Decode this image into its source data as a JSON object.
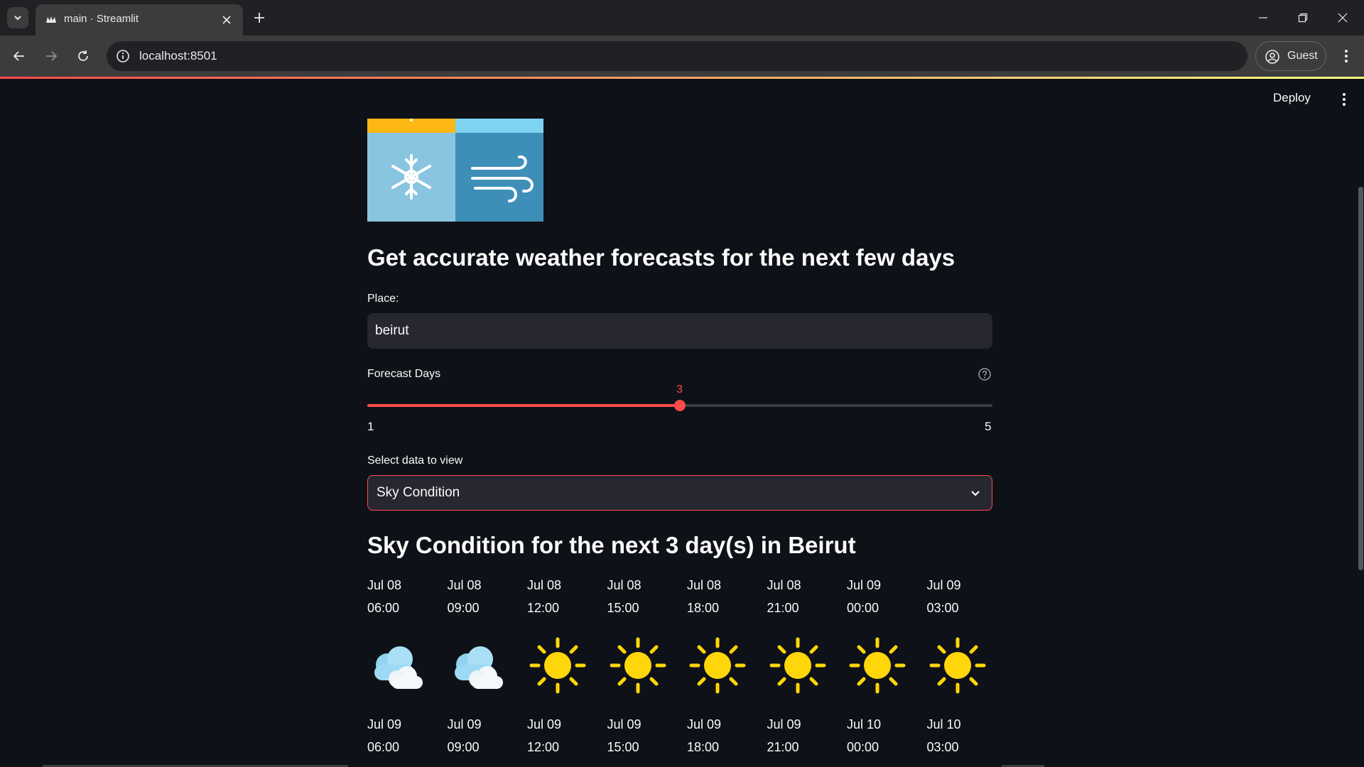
{
  "browser": {
    "tab_title": "main · Streamlit",
    "url": "localhost:8501",
    "profile_label": "Guest"
  },
  "app": {
    "deploy_label": "Deploy",
    "headline": "Get accurate weather forecasts for the next few days",
    "place": {
      "label": "Place:",
      "value": "beirut"
    },
    "forecast_days": {
      "label": "Forecast Days",
      "value": 3,
      "value_text": "3",
      "min": 1,
      "max": 5,
      "min_text": "1",
      "max_text": "5",
      "fill_fraction": 0.5
    },
    "data_select": {
      "label": "Select data to view",
      "value": "Sky Condition"
    },
    "subheadline": "Sky Condition for the next 3 day(s) in Beirut",
    "forecast": [
      {
        "date": "Jul 08",
        "time": "06:00",
        "icon": "cloud-icon"
      },
      {
        "date": "Jul 08",
        "time": "09:00",
        "icon": "cloud-icon"
      },
      {
        "date": "Jul 08",
        "time": "12:00",
        "icon": "sun-icon"
      },
      {
        "date": "Jul 08",
        "time": "15:00",
        "icon": "sun-icon"
      },
      {
        "date": "Jul 08",
        "time": "18:00",
        "icon": "sun-icon"
      },
      {
        "date": "Jul 08",
        "time": "21:00",
        "icon": "sun-icon"
      },
      {
        "date": "Jul 09",
        "time": "00:00",
        "icon": "sun-icon"
      },
      {
        "date": "Jul 09",
        "time": "03:00",
        "icon": "sun-icon"
      },
      {
        "date": "Jul 09",
        "time": "06:00",
        "icon": ""
      },
      {
        "date": "Jul 09",
        "time": "09:00",
        "icon": ""
      },
      {
        "date": "Jul 09",
        "time": "12:00",
        "icon": ""
      },
      {
        "date": "Jul 09",
        "time": "15:00",
        "icon": ""
      },
      {
        "date": "Jul 09",
        "time": "18:00",
        "icon": ""
      },
      {
        "date": "Jul 09",
        "time": "21:00",
        "icon": ""
      },
      {
        "date": "Jul 10",
        "time": "00:00",
        "icon": ""
      },
      {
        "date": "Jul 10",
        "time": "03:00",
        "icon": ""
      }
    ]
  },
  "colors": {
    "accent": "#ff4b4b",
    "background": "#0e1117",
    "input_bg": "#262730"
  }
}
